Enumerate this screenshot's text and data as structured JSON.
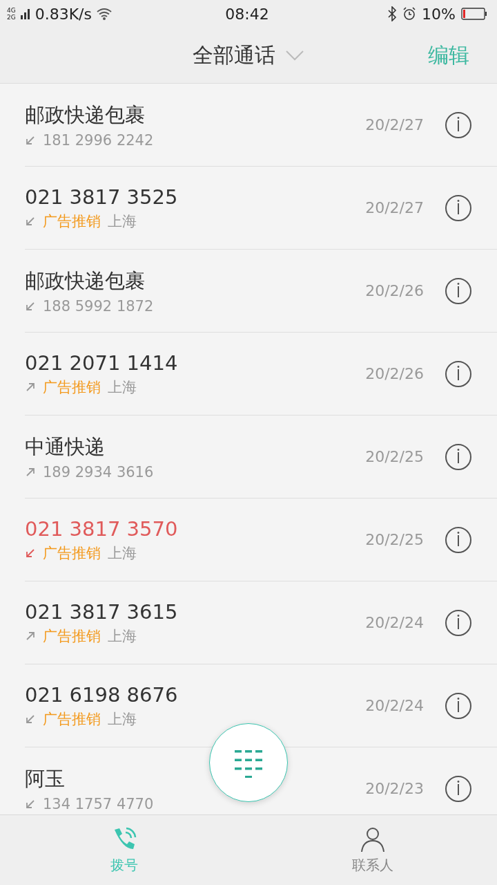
{
  "status_bar": {
    "networks": [
      "4G",
      "2G"
    ],
    "speed": "0.83K/s",
    "time": "08:42",
    "battery_text": "10%",
    "battery": {
      "level": 0.1
    }
  },
  "header": {
    "title": "全部通话",
    "action": "编辑"
  },
  "calls": [
    {
      "name": "邮政快递包裹",
      "outgoing": false,
      "missed": false,
      "number": "181 2996 2242",
      "date": "20/2/27"
    },
    {
      "name": "021 3817 3525",
      "outgoing": false,
      "missed": false,
      "tag": "广告推销",
      "location": "上海",
      "date": "20/2/27"
    },
    {
      "name": "邮政快递包裹",
      "outgoing": false,
      "missed": false,
      "number": "188 5992 1872",
      "date": "20/2/26"
    },
    {
      "name": "021 2071 1414",
      "outgoing": true,
      "missed": false,
      "tag": "广告推销",
      "location": "上海",
      "date": "20/2/26"
    },
    {
      "name": "中通快递",
      "outgoing": true,
      "missed": false,
      "number": "189 2934 3616",
      "date": "20/2/25"
    },
    {
      "name": "021 3817 3570",
      "outgoing": false,
      "missed": true,
      "tag": "广告推销",
      "location": "上海",
      "date": "20/2/25"
    },
    {
      "name": "021 3817 3615",
      "outgoing": true,
      "missed": false,
      "tag": "广告推销",
      "location": "上海",
      "date": "20/2/24"
    },
    {
      "name": "021 6198 8676",
      "outgoing": false,
      "missed": false,
      "tag": "广告推销",
      "location": "上海",
      "date": "20/2/24"
    },
    {
      "name": "阿玉",
      "outgoing": false,
      "missed": false,
      "number": "134 1757 4770",
      "date": "20/2/23"
    }
  ],
  "tabs": [
    {
      "kind": "dial",
      "label": "拨号",
      "selected": true
    },
    {
      "kind": "contacts",
      "label": "联系人",
      "selected": false
    }
  ]
}
